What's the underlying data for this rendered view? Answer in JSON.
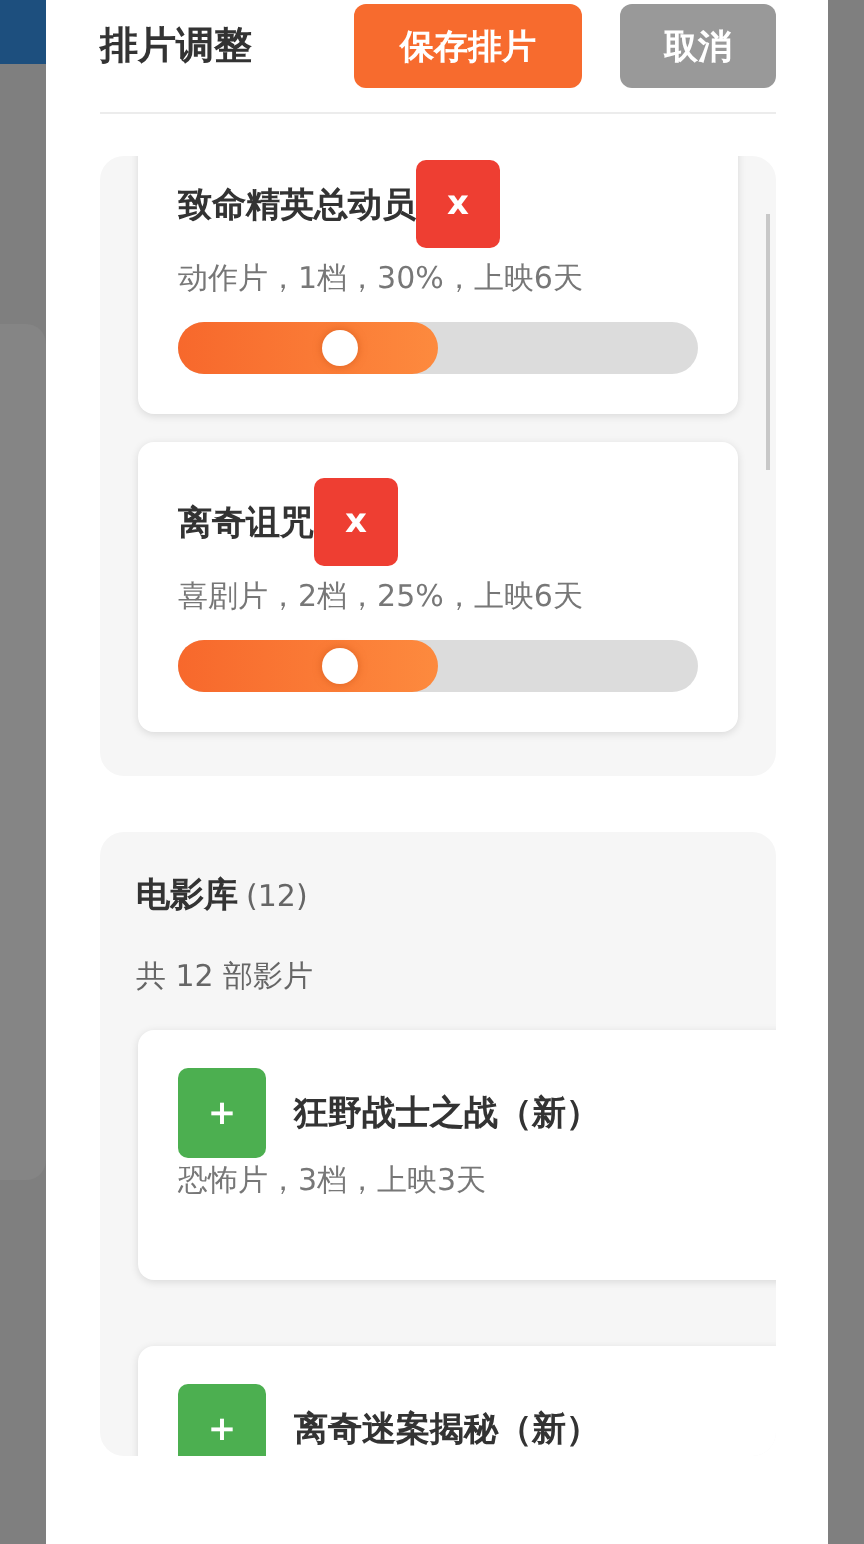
{
  "dialog": {
    "title": "排片调整",
    "buttons": [
      {
        "label": "保存排片",
        "kind": "primary"
      },
      {
        "label": "取消",
        "kind": "secondary"
      }
    ]
  },
  "scheduled": [
    {
      "title": "致命精英总动员",
      "remove": "x",
      "info": "动作片，1档，30%，上映6天",
      "level": 0.5
    },
    {
      "title": "离奇诅咒",
      "remove": "x",
      "info": "喜剧片，2档，25%，上映6天",
      "level": 0.5
    }
  ],
  "library": {
    "title": "电影库",
    "count": "(12)",
    "summary": "共 12 部影片",
    "movies": [
      {
        "add": "+",
        "title": "狂野战士之战（新）",
        "info": "恐怖片，3档，上映3天"
      },
      {
        "add": "+",
        "title": "离奇迷案揭秘（新）"
      }
    ]
  }
}
